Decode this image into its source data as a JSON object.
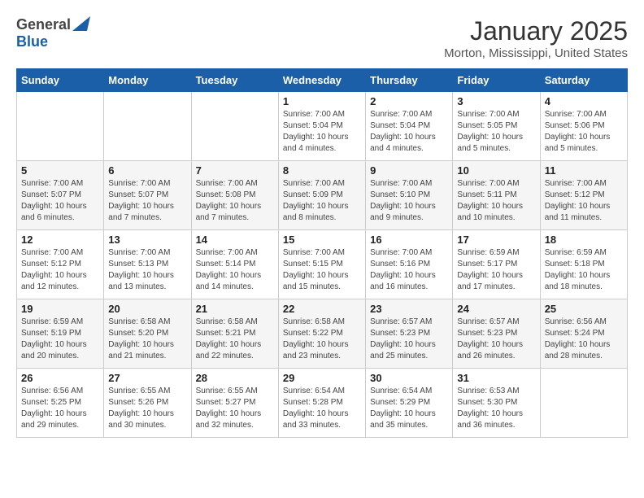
{
  "header": {
    "logo_general": "General",
    "logo_blue": "Blue",
    "month_year": "January 2025",
    "location": "Morton, Mississippi, United States"
  },
  "days_of_week": [
    "Sunday",
    "Monday",
    "Tuesday",
    "Wednesday",
    "Thursday",
    "Friday",
    "Saturday"
  ],
  "weeks": [
    [
      {
        "day": "",
        "info": ""
      },
      {
        "day": "",
        "info": ""
      },
      {
        "day": "",
        "info": ""
      },
      {
        "day": "1",
        "info": "Sunrise: 7:00 AM\nSunset: 5:04 PM\nDaylight: 10 hours\nand 4 minutes."
      },
      {
        "day": "2",
        "info": "Sunrise: 7:00 AM\nSunset: 5:04 PM\nDaylight: 10 hours\nand 4 minutes."
      },
      {
        "day": "3",
        "info": "Sunrise: 7:00 AM\nSunset: 5:05 PM\nDaylight: 10 hours\nand 5 minutes."
      },
      {
        "day": "4",
        "info": "Sunrise: 7:00 AM\nSunset: 5:06 PM\nDaylight: 10 hours\nand 5 minutes."
      }
    ],
    [
      {
        "day": "5",
        "info": "Sunrise: 7:00 AM\nSunset: 5:07 PM\nDaylight: 10 hours\nand 6 minutes."
      },
      {
        "day": "6",
        "info": "Sunrise: 7:00 AM\nSunset: 5:07 PM\nDaylight: 10 hours\nand 7 minutes."
      },
      {
        "day": "7",
        "info": "Sunrise: 7:00 AM\nSunset: 5:08 PM\nDaylight: 10 hours\nand 7 minutes."
      },
      {
        "day": "8",
        "info": "Sunrise: 7:00 AM\nSunset: 5:09 PM\nDaylight: 10 hours\nand 8 minutes."
      },
      {
        "day": "9",
        "info": "Sunrise: 7:00 AM\nSunset: 5:10 PM\nDaylight: 10 hours\nand 9 minutes."
      },
      {
        "day": "10",
        "info": "Sunrise: 7:00 AM\nSunset: 5:11 PM\nDaylight: 10 hours\nand 10 minutes."
      },
      {
        "day": "11",
        "info": "Sunrise: 7:00 AM\nSunset: 5:12 PM\nDaylight: 10 hours\nand 11 minutes."
      }
    ],
    [
      {
        "day": "12",
        "info": "Sunrise: 7:00 AM\nSunset: 5:12 PM\nDaylight: 10 hours\nand 12 minutes."
      },
      {
        "day": "13",
        "info": "Sunrise: 7:00 AM\nSunset: 5:13 PM\nDaylight: 10 hours\nand 13 minutes."
      },
      {
        "day": "14",
        "info": "Sunrise: 7:00 AM\nSunset: 5:14 PM\nDaylight: 10 hours\nand 14 minutes."
      },
      {
        "day": "15",
        "info": "Sunrise: 7:00 AM\nSunset: 5:15 PM\nDaylight: 10 hours\nand 15 minutes."
      },
      {
        "day": "16",
        "info": "Sunrise: 7:00 AM\nSunset: 5:16 PM\nDaylight: 10 hours\nand 16 minutes."
      },
      {
        "day": "17",
        "info": "Sunrise: 6:59 AM\nSunset: 5:17 PM\nDaylight: 10 hours\nand 17 minutes."
      },
      {
        "day": "18",
        "info": "Sunrise: 6:59 AM\nSunset: 5:18 PM\nDaylight: 10 hours\nand 18 minutes."
      }
    ],
    [
      {
        "day": "19",
        "info": "Sunrise: 6:59 AM\nSunset: 5:19 PM\nDaylight: 10 hours\nand 20 minutes."
      },
      {
        "day": "20",
        "info": "Sunrise: 6:58 AM\nSunset: 5:20 PM\nDaylight: 10 hours\nand 21 minutes."
      },
      {
        "day": "21",
        "info": "Sunrise: 6:58 AM\nSunset: 5:21 PM\nDaylight: 10 hours\nand 22 minutes."
      },
      {
        "day": "22",
        "info": "Sunrise: 6:58 AM\nSunset: 5:22 PM\nDaylight: 10 hours\nand 23 minutes."
      },
      {
        "day": "23",
        "info": "Sunrise: 6:57 AM\nSunset: 5:23 PM\nDaylight: 10 hours\nand 25 minutes."
      },
      {
        "day": "24",
        "info": "Sunrise: 6:57 AM\nSunset: 5:23 PM\nDaylight: 10 hours\nand 26 minutes."
      },
      {
        "day": "25",
        "info": "Sunrise: 6:56 AM\nSunset: 5:24 PM\nDaylight: 10 hours\nand 28 minutes."
      }
    ],
    [
      {
        "day": "26",
        "info": "Sunrise: 6:56 AM\nSunset: 5:25 PM\nDaylight: 10 hours\nand 29 minutes."
      },
      {
        "day": "27",
        "info": "Sunrise: 6:55 AM\nSunset: 5:26 PM\nDaylight: 10 hours\nand 30 minutes."
      },
      {
        "day": "28",
        "info": "Sunrise: 6:55 AM\nSunset: 5:27 PM\nDaylight: 10 hours\nand 32 minutes."
      },
      {
        "day": "29",
        "info": "Sunrise: 6:54 AM\nSunset: 5:28 PM\nDaylight: 10 hours\nand 33 minutes."
      },
      {
        "day": "30",
        "info": "Sunrise: 6:54 AM\nSunset: 5:29 PM\nDaylight: 10 hours\nand 35 minutes."
      },
      {
        "day": "31",
        "info": "Sunrise: 6:53 AM\nSunset: 5:30 PM\nDaylight: 10 hours\nand 36 minutes."
      },
      {
        "day": "",
        "info": ""
      }
    ]
  ]
}
